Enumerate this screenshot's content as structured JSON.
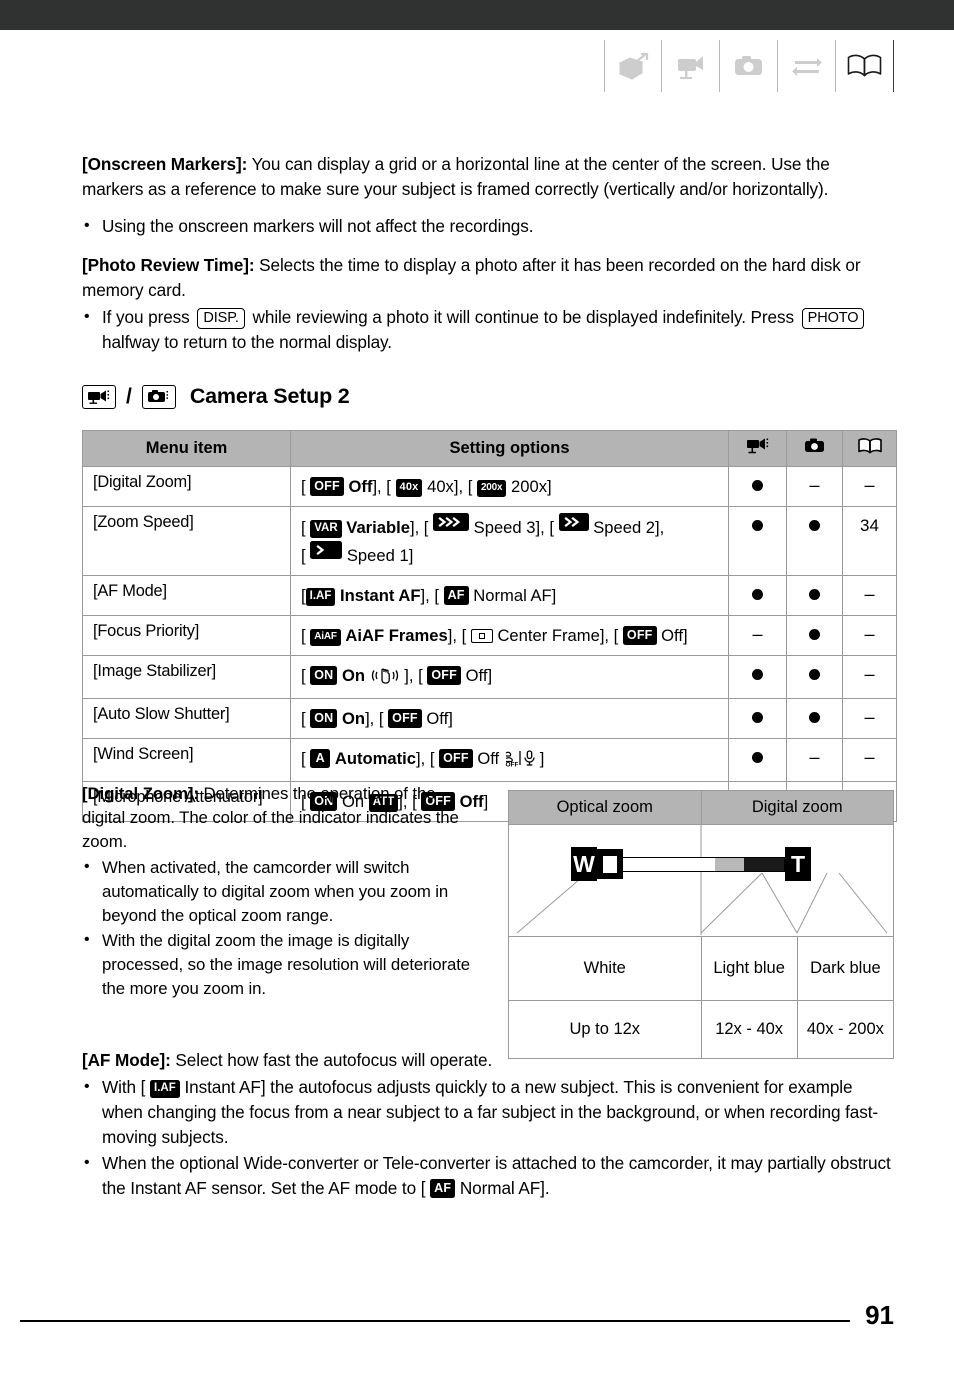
{
  "page": {
    "number": "91"
  },
  "header": {
    "icons": [
      {
        "name": "package-box-icon",
        "state": "inactive"
      },
      {
        "name": "camcorder-icon",
        "state": "inactive"
      },
      {
        "name": "photo-camera-icon",
        "state": "inactive"
      },
      {
        "name": "transfer-arrows-icon",
        "state": "inactive"
      },
      {
        "name": "open-book-icon",
        "state": "active"
      }
    ]
  },
  "intro": {
    "onscreen_markers": {
      "term": "[Onscreen Markers]:",
      "body": " You can display a grid or a horizontal line at the center of the screen. Use the markers as a reference to make sure your subject is framed correctly (vertically and/or horizontally).",
      "bullets": [
        "Using the onscreen markers will not affect the recordings."
      ]
    },
    "photo_review_time": {
      "term": "[Photo Review Time]:",
      "body": " Selects the time to display a photo after it has been recorded on the hard disk or memory card.",
      "bullet_pre": "If you press",
      "key1": "DISP.",
      "bullet_mid": "while reviewing a photo it will continue to be displayed indefinitely. Press",
      "key2": "PHOTO",
      "bullet_post": "halfway to return to the normal display."
    }
  },
  "section": {
    "slash": "/",
    "title": "Camera Setup 2",
    "mode_icons": [
      "camcorder-icon",
      "photo-camera-icon"
    ]
  },
  "table": {
    "headers": {
      "menu_item": "Menu item",
      "setting_options": "Setting options",
      "col_movie": "camcorder-icon",
      "col_photo": "photo-camera-icon",
      "col_ref": "open-book-icon"
    },
    "rows": [
      {
        "item": "[Digital Zoom]",
        "options": [
          {
            "chip": "OFF",
            "chip_style": "off",
            "label": "Off",
            "bold": true,
            "bracket_open": true,
            "bracket_close": true,
            "sep": ", "
          },
          {
            "chip": "40x",
            "chip_style": "small",
            "label": "40x",
            "bold": false,
            "bracket_open": true,
            "bracket_close": true,
            "sep": ", "
          },
          {
            "chip": "200x",
            "chip_style": "tiny",
            "label": "200x",
            "bold": false,
            "bracket_open": true,
            "bracket_close": true,
            "sep": ""
          }
        ],
        "movie": "dot",
        "photo": "dash",
        "ref": "dash"
      },
      {
        "item": "[Zoom Speed]",
        "options": [
          {
            "chip": "VAR",
            "chip_style": "wide",
            "label": "Variable",
            "bold": true,
            "bracket_open": true,
            "bracket_close": true,
            "sep": ", "
          },
          {
            "chip": "speed3-icon",
            "chip_style": "glyph",
            "label": "Speed 3",
            "bold": false,
            "bracket_open": true,
            "bracket_close": true,
            "sep": ", "
          },
          {
            "chip": "speed2-icon",
            "chip_style": "glyph",
            "label": "Speed 2",
            "bold": false,
            "bracket_open": true,
            "bracket_close": true,
            "sep": ",|break"
          },
          {
            "chip": "speed1-icon",
            "chip_style": "glyph",
            "label": "Speed 1",
            "bold": false,
            "bracket_open": true,
            "bracket_close": true,
            "sep": ""
          }
        ],
        "movie": "dot",
        "photo": "dot",
        "ref": "34"
      },
      {
        "item": "[AF Mode]",
        "options": [
          {
            "chip": "I.AF",
            "chip_style": "wide",
            "label": "Instant AF",
            "bold": true,
            "bracket_open": true,
            "bracket_close": true,
            "sep": ", "
          },
          {
            "chip": "AF",
            "chip_style": "off",
            "label": "Normal AF",
            "bold": false,
            "bracket_open": true,
            "bracket_close": true,
            "sep": ""
          }
        ],
        "movie": "dot",
        "photo": "dot",
        "ref": "dash"
      },
      {
        "item": "[Focus Priority]",
        "options": [
          {
            "chip": "AiAF",
            "chip_style": "tiny",
            "label": "AiAF Frames",
            "bold": true,
            "bracket_open": true,
            "bracket_close": true,
            "sep": ", "
          },
          {
            "chip": "center-frame-icon",
            "chip_style": "outline",
            "label": "Center Frame",
            "bold": false,
            "bracket_open": true,
            "bracket_close": true,
            "sep": ", "
          },
          {
            "chip": "OFF",
            "chip_style": "off",
            "label": "Off",
            "bold": false,
            "bracket_open": true,
            "bracket_close": true,
            "sep": ""
          }
        ],
        "movie": "dash",
        "photo": "dot",
        "ref": "dash"
      },
      {
        "item": "[Image Stabilizer]",
        "options": [
          {
            "chip": "ON",
            "chip_style": "off",
            "label": "On",
            "bold": true,
            "trailing_icon": "image-stabilizer-hand-icon",
            "bracket_open": true,
            "bracket_close": true,
            "sep": ", "
          },
          {
            "chip": "OFF",
            "chip_style": "off",
            "label": "Off",
            "bold": false,
            "bracket_open": true,
            "bracket_close": true,
            "sep": ""
          }
        ],
        "movie": "dot",
        "photo": "dot",
        "ref": "dash"
      },
      {
        "item": "[Auto Slow Shutter]",
        "options": [
          {
            "chip": "ON",
            "chip_style": "off",
            "label": "On",
            "bold": true,
            "bracket_open": true,
            "bracket_close": true,
            "sep": ", "
          },
          {
            "chip": "OFF",
            "chip_style": "off",
            "label": "Off",
            "bold": false,
            "bracket_open": true,
            "bracket_close": true,
            "sep": ""
          }
        ],
        "movie": "dot",
        "photo": "dot",
        "ref": "dash"
      },
      {
        "item": "[Wind Screen]",
        "options": [
          {
            "chip": "A",
            "chip_style": "off",
            "label": "Automatic",
            "bold": true,
            "bracket_open": true,
            "bracket_close": true,
            "sep": ", "
          },
          {
            "chip": "OFF",
            "chip_style": "off",
            "label": "Off",
            "bold": false,
            "trailing_icon": "wind-off-mic-icon",
            "bracket_open": true,
            "bracket_close": true,
            "sep": ""
          }
        ],
        "movie": "dot",
        "photo": "dash",
        "ref": "dash"
      },
      {
        "item": "[Microphone Attenuator]",
        "options": [
          {
            "chip": "ON",
            "chip_style": "off",
            "label": "On",
            "bold": false,
            "trailing_chip": "ATT",
            "bracket_open": true,
            "bracket_close": true,
            "sep": ", "
          },
          {
            "chip": "OFF",
            "chip_style": "off",
            "label": "Off",
            "bold": true,
            "bracket_open": true,
            "bracket_close": true,
            "sep": ""
          }
        ],
        "movie": "dot",
        "photo": "dash",
        "ref": "dash"
      }
    ]
  },
  "digital_zoom": {
    "term": "[Digital Zoom]:",
    "body": " Determines the operation of the digital zoom. The color of the indicator indicates the zoom.",
    "bullets": [
      "When activated, the camcorder will switch automatically to digital zoom when you zoom in beyond the optical zoom range.",
      "With the digital zoom the image is digitally processed, so the image resolution will deteriorate the more you zoom in."
    ]
  },
  "zoom_figure": {
    "headers": [
      "Optical zoom",
      "Digital zoom"
    ],
    "indicator": {
      "wide_badge": "W",
      "tele_badge": "T",
      "segments": [
        {
          "name": "white",
          "color": "#ffffff",
          "width_pct": 57
        },
        {
          "name": "light-blue",
          "color": "#b9b9b9",
          "width_pct": 18
        },
        {
          "name": "dark-blue",
          "color": "#1a1a1a",
          "width_pct": 25
        }
      ]
    },
    "colors": [
      "White",
      "Light blue",
      "Dark blue"
    ],
    "ranges": [
      "Up to 12x",
      "12x - 40x",
      "40x - 200x"
    ]
  },
  "af_mode": {
    "term": "[AF Mode]:",
    "body": " Select how fast the autofocus will operate.",
    "bullet1_pre": "With [",
    "bullet1_chip": "I.AF",
    "bullet1_post": "Instant AF] the autofocus adjusts quickly to a new subject. This is convenient for example when changing the focus from a near subject to a far subject in the background, or when recording fast-moving subjects.",
    "bullet2_pre": "When the optional Wide-converter or Tele-converter is attached to the camcorder, it may partially obstruct the Instant AF sensor. Set the AF mode to [",
    "bullet2_chip": "AF",
    "bullet2_post": "Normal AF]."
  }
}
